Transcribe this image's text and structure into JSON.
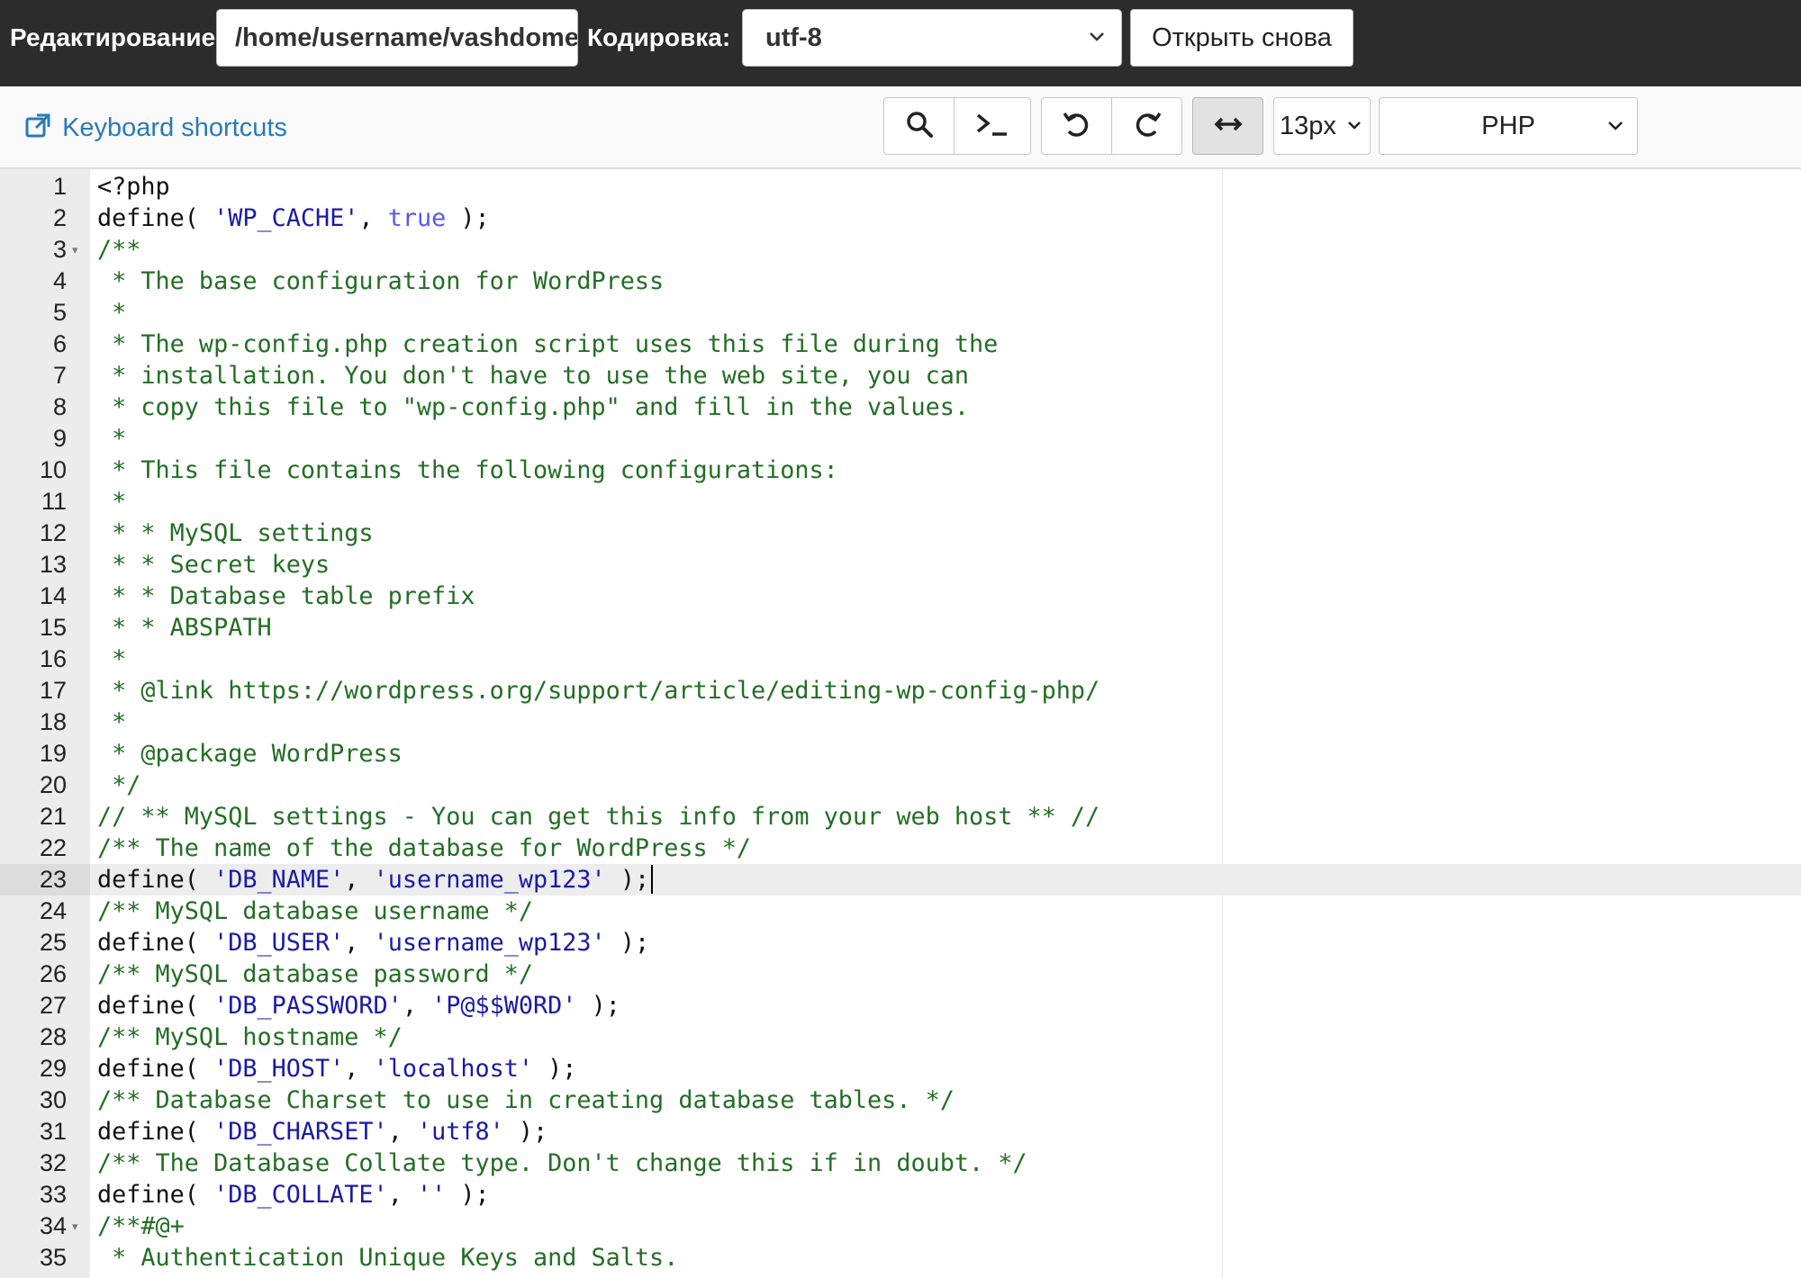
{
  "topbar": {
    "edit_label": "Редактирование:",
    "path_value": "/home/username/vashdomen.ru/public_html/wp-config.php",
    "encoding_label": "Кодировка:",
    "encoding_value": "utf-8",
    "reopen_label": "Открыть снова"
  },
  "toolbar": {
    "shortcuts_label": "Keyboard shortcuts",
    "font_size": "13px",
    "mode": "PHP",
    "icons": [
      "search-icon",
      "terminal-icon",
      "undo-icon",
      "redo-icon",
      "wrap-toggle-icon"
    ]
  },
  "colors": {
    "comment": "#236e24",
    "string": "#1a1aa6",
    "constant": "#5858f0",
    "link": "#2a7ab8"
  },
  "editor": {
    "active_line": 23,
    "fold_lines": [
      3,
      34
    ],
    "lines": [
      [
        [
          "",
          "<?php"
        ]
      ],
      [
        [
          "",
          "define( "
        ],
        [
          "st",
          "'WP_CACHE'"
        ],
        [
          "",
          ", "
        ],
        [
          "kw",
          "true"
        ],
        [
          "",
          " );"
        ]
      ],
      [
        [
          "cm",
          "/**"
        ]
      ],
      [
        [
          "cm",
          " * The base configuration for WordPress"
        ]
      ],
      [
        [
          "cm",
          " *"
        ]
      ],
      [
        [
          "cm",
          " * The wp-config.php creation script uses this file during the"
        ]
      ],
      [
        [
          "cm",
          " * installation. You don't have to use the web site, you can"
        ]
      ],
      [
        [
          "cm",
          " * copy this file to \"wp-config.php\" and fill in the values."
        ]
      ],
      [
        [
          "cm",
          " *"
        ]
      ],
      [
        [
          "cm",
          " * This file contains the following configurations:"
        ]
      ],
      [
        [
          "cm",
          " *"
        ]
      ],
      [
        [
          "cm",
          " * * MySQL settings"
        ]
      ],
      [
        [
          "cm",
          " * * Secret keys"
        ]
      ],
      [
        [
          "cm",
          " * * Database table prefix"
        ]
      ],
      [
        [
          "cm",
          " * * ABSPATH"
        ]
      ],
      [
        [
          "cm",
          " *"
        ]
      ],
      [
        [
          "cm",
          " * @link https://wordpress.org/support/article/editing-wp-config-php/"
        ]
      ],
      [
        [
          "cm",
          " *"
        ]
      ],
      [
        [
          "cm",
          " * @package WordPress"
        ]
      ],
      [
        [
          "cm",
          " */"
        ]
      ],
      [
        [
          "cm",
          "// ** MySQL settings - You can get this info from your web host ** //"
        ]
      ],
      [
        [
          "cm",
          "/** The name of the database for WordPress */"
        ]
      ],
      [
        [
          "",
          "define( "
        ],
        [
          "st",
          "'DB_NAME'"
        ],
        [
          "",
          ", "
        ],
        [
          "st",
          "'username_wp123'"
        ],
        [
          "",
          " );"
        ]
      ],
      [
        [
          "cm",
          "/** MySQL database username */"
        ]
      ],
      [
        [
          "",
          "define( "
        ],
        [
          "st",
          "'DB_USER'"
        ],
        [
          "",
          ", "
        ],
        [
          "st",
          "'username_wp123'"
        ],
        [
          "",
          " );"
        ]
      ],
      [
        [
          "cm",
          "/** MySQL database password */"
        ]
      ],
      [
        [
          "",
          "define( "
        ],
        [
          "st",
          "'DB_PASSWORD'"
        ],
        [
          "",
          ", "
        ],
        [
          "st",
          "'P@$$W0RD'"
        ],
        [
          "",
          " );"
        ]
      ],
      [
        [
          "cm",
          "/** MySQL hostname */"
        ]
      ],
      [
        [
          "",
          "define( "
        ],
        [
          "st",
          "'DB_HOST'"
        ],
        [
          "",
          ", "
        ],
        [
          "st",
          "'localhost'"
        ],
        [
          "",
          " );"
        ]
      ],
      [
        [
          "cm",
          "/** Database Charset to use in creating database tables. */"
        ]
      ],
      [
        [
          "",
          "define( "
        ],
        [
          "st",
          "'DB_CHARSET'"
        ],
        [
          "",
          ", "
        ],
        [
          "st",
          "'utf8'"
        ],
        [
          "",
          " );"
        ]
      ],
      [
        [
          "cm",
          "/** The Database Collate type. Don't change this if in doubt. */"
        ]
      ],
      [
        [
          "",
          "define( "
        ],
        [
          "st",
          "'DB_COLLATE'"
        ],
        [
          "",
          ", "
        ],
        [
          "st",
          "''"
        ],
        [
          "",
          " );"
        ]
      ],
      [
        [
          "cm",
          "/**#@+"
        ]
      ],
      [
        [
          "cm",
          " * Authentication Unique Keys and Salts."
        ]
      ]
    ]
  }
}
